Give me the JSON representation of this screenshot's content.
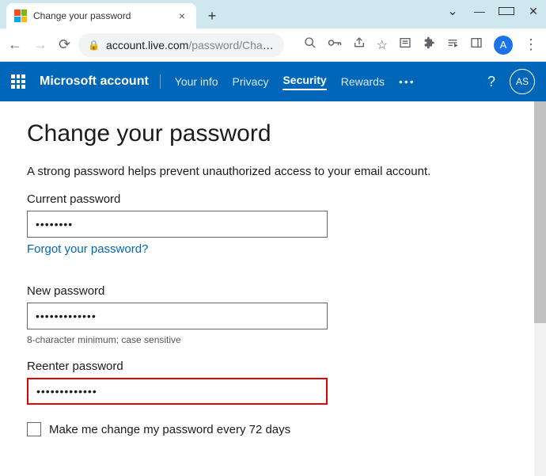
{
  "browser": {
    "tab_title": "Change your password",
    "url_host": "account.live.com",
    "url_path": "/password/Chang…",
    "avatar_letter": "A"
  },
  "header": {
    "brand": "Microsoft account",
    "nav": [
      "Your info",
      "Privacy",
      "Security",
      "Rewards"
    ],
    "active_index": 2,
    "avatar_initials": "AS"
  },
  "page": {
    "heading": "Change your password",
    "subtitle": "A strong password helps prevent unauthorized access to your email account.",
    "current_label": "Current password",
    "current_value": "••••••••",
    "forgot_link": "Forgot your password?",
    "new_label": "New password",
    "new_value": "•••••••••••••",
    "hint": "8-character minimum; case sensitive",
    "reenter_label": "Reenter password",
    "reenter_value": "•••••••••••••",
    "checkbox_label": "Make me change my password every 72 days"
  }
}
